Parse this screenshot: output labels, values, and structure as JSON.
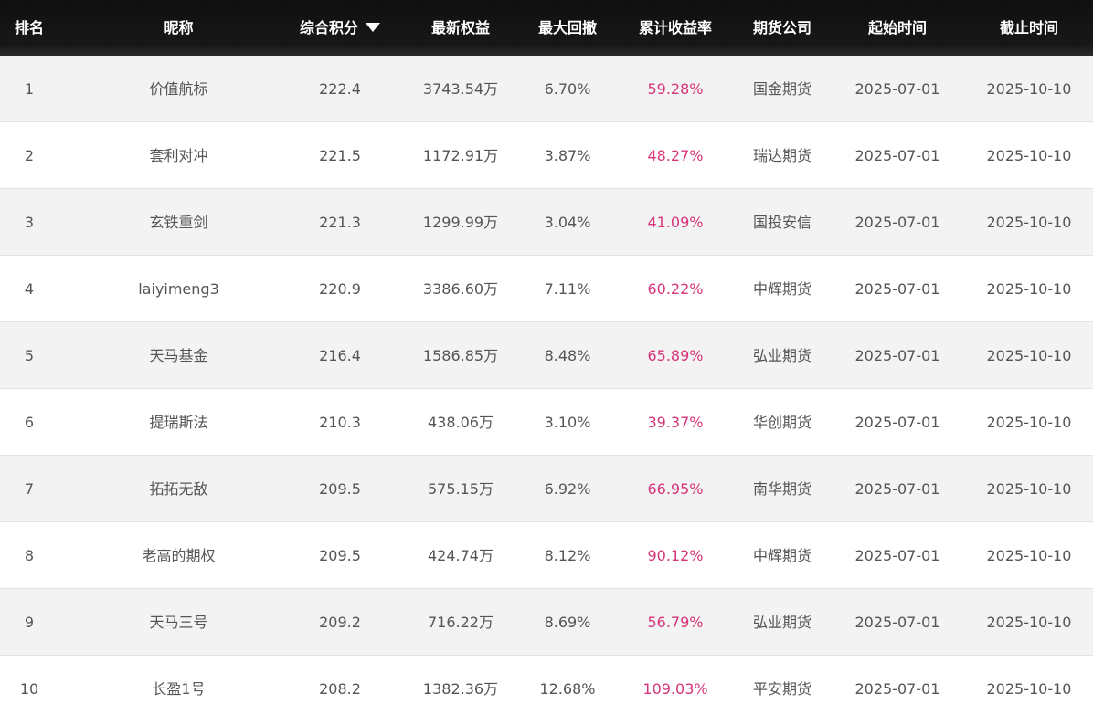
{
  "header": {
    "rank": "排名",
    "nickname": "昵称",
    "score": "综合积分",
    "equity": "最新权益",
    "drawdown": "最大回撤",
    "return": "累计收益率",
    "company": "期货公司",
    "start": "起始时间",
    "end": "截止时间"
  },
  "icons": {
    "sort": "sort-desc-triangle-icon"
  },
  "colors": {
    "header_bg": "#141414",
    "header_text": "#ffffff",
    "return_text": "#d6357a",
    "row_alt_bg": "#f3f3f3",
    "text": "#555555"
  },
  "rows": [
    {
      "rank": "1",
      "nickname": "价值航标",
      "score": "222.4",
      "equity": "3743.54万",
      "drawdown": "6.70%",
      "return": "59.28%",
      "company": "国金期货",
      "start": "2025-07-01",
      "end": "2025-10-10"
    },
    {
      "rank": "2",
      "nickname": "套利对冲",
      "score": "221.5",
      "equity": "1172.91万",
      "drawdown": "3.87%",
      "return": "48.27%",
      "company": "瑞达期货",
      "start": "2025-07-01",
      "end": "2025-10-10"
    },
    {
      "rank": "3",
      "nickname": "玄铁重剑",
      "score": "221.3",
      "equity": "1299.99万",
      "drawdown": "3.04%",
      "return": "41.09%",
      "company": "国投安信",
      "start": "2025-07-01",
      "end": "2025-10-10"
    },
    {
      "rank": "4",
      "nickname": "laiyimeng3",
      "score": "220.9",
      "equity": "3386.60万",
      "drawdown": "7.11%",
      "return": "60.22%",
      "company": "中辉期货",
      "start": "2025-07-01",
      "end": "2025-10-10"
    },
    {
      "rank": "5",
      "nickname": "天马基金",
      "score": "216.4",
      "equity": "1586.85万",
      "drawdown": "8.48%",
      "return": "65.89%",
      "company": "弘业期货",
      "start": "2025-07-01",
      "end": "2025-10-10"
    },
    {
      "rank": "6",
      "nickname": "提瑞斯法",
      "score": "210.3",
      "equity": "438.06万",
      "drawdown": "3.10%",
      "return": "39.37%",
      "company": "华创期货",
      "start": "2025-07-01",
      "end": "2025-10-10"
    },
    {
      "rank": "7",
      "nickname": "拓拓无敌",
      "score": "209.5",
      "equity": "575.15万",
      "drawdown": "6.92%",
      "return": "66.95%",
      "company": "南华期货",
      "start": "2025-07-01",
      "end": "2025-10-10"
    },
    {
      "rank": "8",
      "nickname": "老高的期权",
      "score": "209.5",
      "equity": "424.74万",
      "drawdown": "8.12%",
      "return": "90.12%",
      "company": "中辉期货",
      "start": "2025-07-01",
      "end": "2025-10-10"
    },
    {
      "rank": "9",
      "nickname": "天马三号",
      "score": "209.2",
      "equity": "716.22万",
      "drawdown": "8.69%",
      "return": "56.79%",
      "company": "弘业期货",
      "start": "2025-07-01",
      "end": "2025-10-10"
    },
    {
      "rank": "10",
      "nickname": "长盈1号",
      "score": "208.2",
      "equity": "1382.36万",
      "drawdown": "12.68%",
      "return": "109.03%",
      "company": "平安期货",
      "start": "2025-07-01",
      "end": "2025-10-10"
    }
  ]
}
